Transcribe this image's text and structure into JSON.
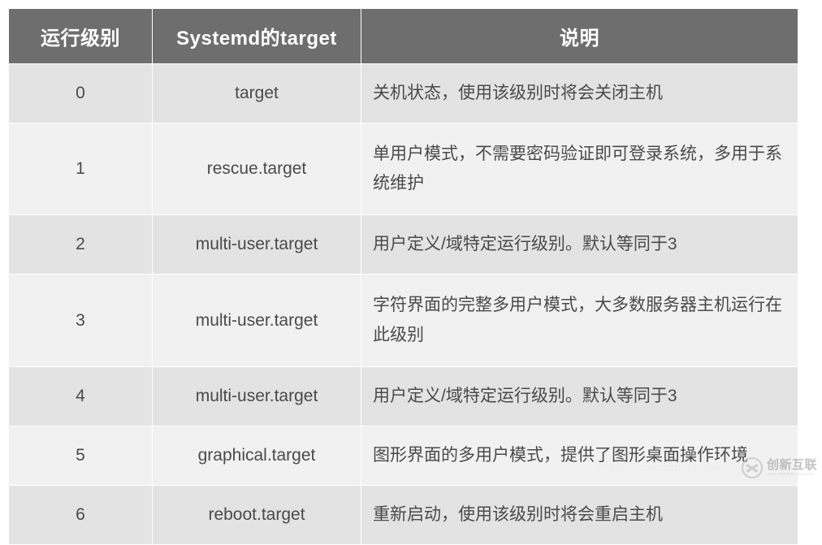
{
  "table": {
    "headers": [
      {
        "label": "运行级别"
      },
      {
        "label": "Systemd的target"
      },
      {
        "label": "说明"
      }
    ],
    "rows": [
      {
        "level": "0",
        "target": "target",
        "description": "关机状态，使用该级别时将会关闭主机",
        "multiline": false
      },
      {
        "level": "1",
        "target": "rescue.target",
        "description": "单用户模式，不需要密码验证即可登录系统，多用于系统维护",
        "multiline": true
      },
      {
        "level": "2",
        "target": "multi-user.target",
        "description": "用户定义/域特定运行级别。默认等同于3",
        "multiline": false
      },
      {
        "level": "3",
        "target": "multi-user.target",
        "description": "字符界面的完整多用户模式，大多数服务器主机运行在此级别",
        "multiline": true
      },
      {
        "level": "4",
        "target": "multi-user.target",
        "description": "用户定义/域特定运行级别。默认等同于3",
        "multiline": false
      },
      {
        "level": "5",
        "target": "graphical.target",
        "description": "图形界面的多用户模式，提供了图形桌面操作环境",
        "multiline": false
      },
      {
        "level": "6",
        "target": "reboot.target",
        "description": "重新启动，使用该级别时将会重启主机",
        "multiline": false
      }
    ]
  },
  "watermarks": {
    "url": "https://blog.csdn.net/wei",
    "brand_cn": "创新互联",
    "brand_en": "CHUANGXIN HULIAN"
  },
  "colors": {
    "header_background": "#6e6e6e",
    "header_text": "#ffffff",
    "row_even_background": "#e3e3e3",
    "row_odd_background": "#f1f1f1",
    "body_text": "#4a4a4a",
    "page_background": "#ffffff"
  }
}
